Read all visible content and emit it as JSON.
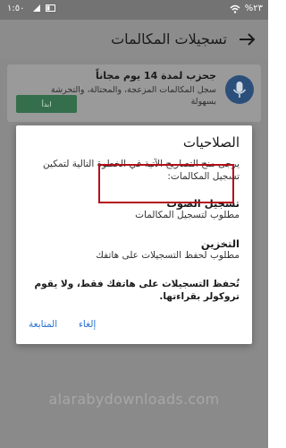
{
  "status_bar": {
    "time": "١:٥٠",
    "battery": "%٢٣"
  },
  "app_bar": {
    "title": "تسجيلات المكالمات"
  },
  "promo": {
    "title": "جحزب لمدة 14 يوم مجاناً",
    "description": "سجل المكالمات المزعجة، والمحتالة، والتحرشة بسهولة",
    "button_label": "ابدأ"
  },
  "dialog": {
    "title": "الصلاحيات",
    "intro": "يرجى منح التصاريح الآتية في الخطوة التالية لتمكين تسجيل المكالمات:",
    "permissions": [
      {
        "title": "تسجيل الصوت",
        "description": "مطلوب لتسجيل المكالمات"
      },
      {
        "title": "التخزين",
        "description": "مطلوب لحفظ التسجيلات على هاتفك"
      }
    ],
    "note": "تُحفظ التسجيلات على هاتفك فقط، ولا يقوم تروكولر بقراءتها.",
    "actions": {
      "cancel": "إلغاء",
      "continue": "المتابعة"
    }
  },
  "watermark": "alarabydownloads.com",
  "colors": {
    "status_bar": "#737373",
    "app_bar": "#8c8c8c",
    "overlay_bg": "#8a8a8a",
    "accent_button": "#356e4b",
    "highlight_border": "#b3101a",
    "link_blue": "#2a73d6"
  }
}
